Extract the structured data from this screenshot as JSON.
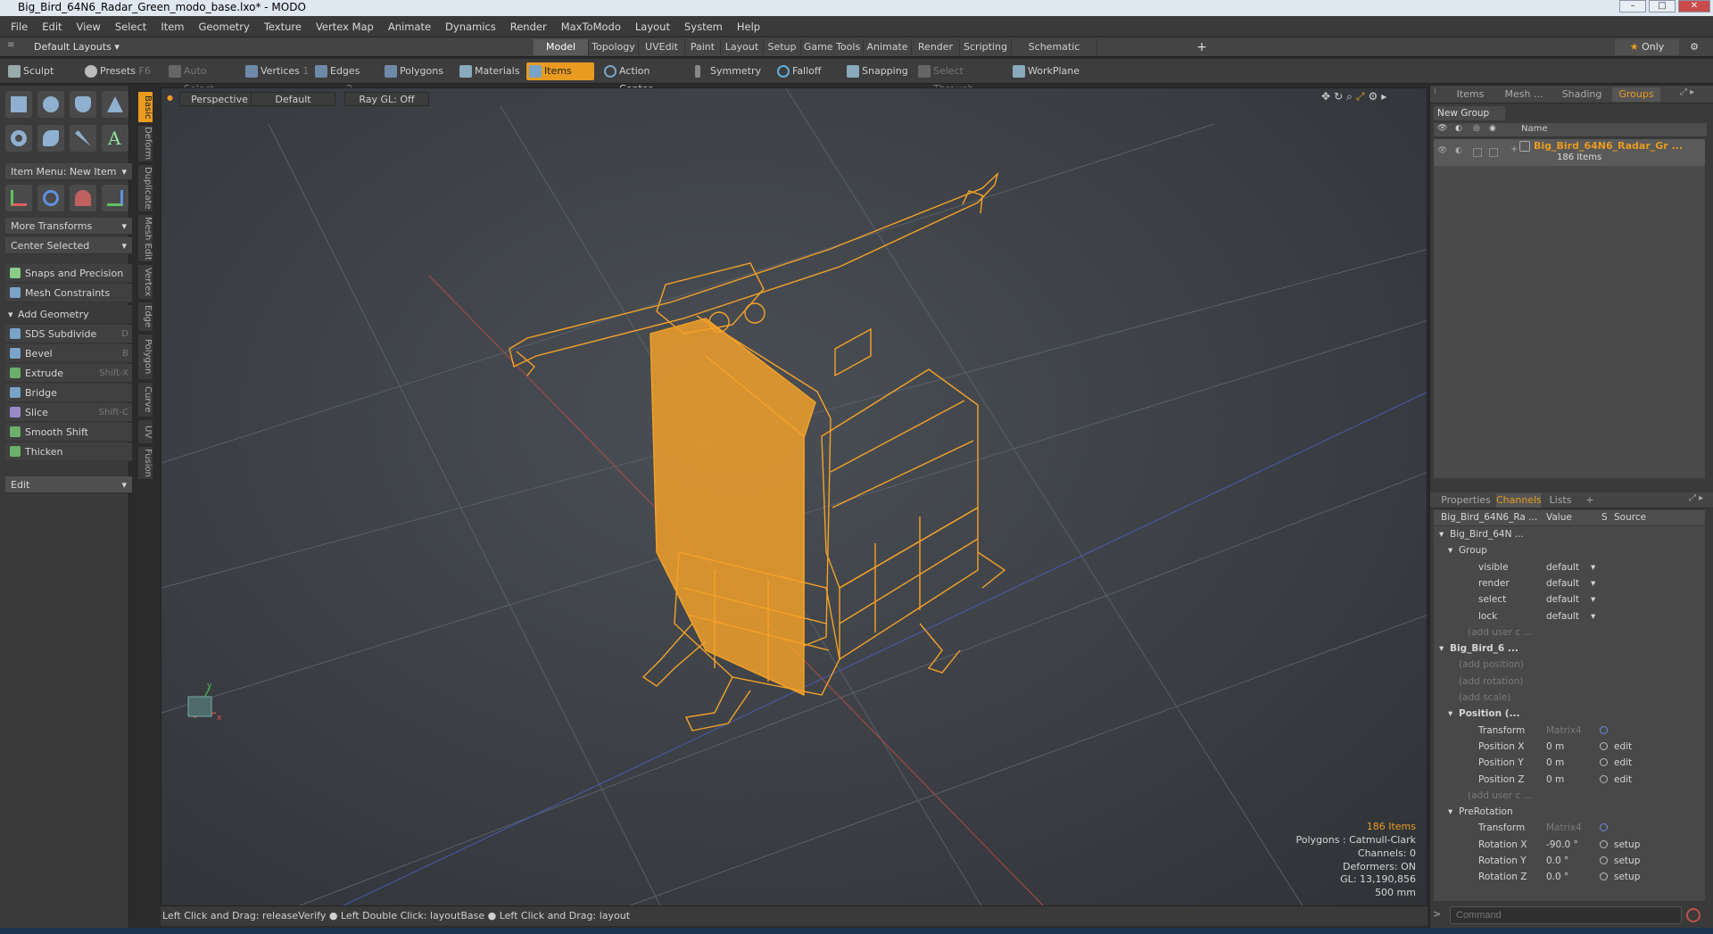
{
  "window": {
    "title": "Big_Bird_64N6_Radar_Green_modo_base.lxo* - MODO"
  },
  "menu": [
    "File",
    "Edit",
    "View",
    "Select",
    "Item",
    "Geometry",
    "Texture",
    "Vertex Map",
    "Animate",
    "Dynamics",
    "Render",
    "MaxToModo",
    "Layout",
    "System",
    "Help"
  ],
  "layouts": {
    "dropdown": "Default Layouts",
    "tabs": [
      "Model",
      "Topology",
      "UVEdit",
      "Paint",
      "Layout",
      "Setup",
      "Game Tools",
      "Animate",
      "Render",
      "Scripting",
      "Schematic Fusion"
    ],
    "active": "Model",
    "add": "+",
    "only": "Only"
  },
  "toolbar": {
    "sculpt": "Sculpt",
    "presets": "Presets",
    "presets_key": "F6",
    "auto_select": "Auto Select",
    "vertices": "Vertices",
    "vertices_key": "1",
    "edges": "Edges",
    "edges_key": "2",
    "polygons": "Polygons",
    "materials": "Materials",
    "items": "Items",
    "action_center": "Action Center",
    "symmetry": "Symmetry",
    "falloff": "Falloff",
    "snapping": "Snapping",
    "select_through": "Select Through",
    "workplane": "WorkPlane"
  },
  "left": {
    "item_menu": "Item Menu: New Item",
    "more_transforms": "More Transforms",
    "center_selected": "Center Selected",
    "snaps": "Snaps and Precision",
    "mesh_constraints": "Mesh Constraints",
    "add_geometry": "Add Geometry",
    "tools": [
      {
        "label": "SDS Subdivide",
        "key": "D"
      },
      {
        "label": "Bevel",
        "key": "B"
      },
      {
        "label": "Extrude",
        "key": "Shift-X"
      },
      {
        "label": "Bridge",
        "key": ""
      },
      {
        "label": "Slice",
        "key": "Shift-C"
      },
      {
        "label": "Smooth Shift",
        "key": ""
      },
      {
        "label": "Thicken",
        "key": ""
      }
    ],
    "edit": "Edit",
    "vtabs": [
      "Basic",
      "Deform",
      "Duplicate",
      "Mesh Edit",
      "Vertex",
      "Edge",
      "Polygon",
      "Curve",
      "UV",
      "Fusion"
    ]
  },
  "viewport": {
    "view": "Perspective",
    "shading": "Default",
    "raygl": "Ray GL: Off",
    "info": {
      "items": "186 Items",
      "polygons": "Polygons : Catmull-Clark",
      "channels": "Channels: 0",
      "deformers": "Deformers: ON",
      "gl": "GL: 13,190,856",
      "scale": "500 mm"
    },
    "wire_color": "#f5a228"
  },
  "groups_panel": {
    "tabs": [
      "Items",
      "Mesh ...",
      "Shading",
      "Groups"
    ],
    "active": "Groups",
    "new_group": "New Group",
    "col_name": "Name",
    "group_name": "Big_Bird_64N6_Radar_Gr ...",
    "group_count": "186 Items"
  },
  "channels_panel": {
    "tabs": [
      "Properties",
      "Channels",
      "Lists"
    ],
    "active": "Channels",
    "add": "+",
    "headers": [
      "Big_Bird_64N6_Ra ...",
      "Value",
      "S",
      "Source"
    ],
    "rows": [
      {
        "name": "Big_Bird_64N ...",
        "value": "",
        "src": "",
        "indent": 1,
        "style": "node"
      },
      {
        "name": "Group",
        "value": "",
        "src": "",
        "indent": 2,
        "style": "node"
      },
      {
        "name": "visible",
        "value": "default",
        "src": "",
        "indent": 3,
        "style": "prop"
      },
      {
        "name": "render",
        "value": "default",
        "src": "",
        "indent": 3,
        "style": "prop"
      },
      {
        "name": "select",
        "value": "default",
        "src": "",
        "indent": 3,
        "style": "prop"
      },
      {
        "name": "lock",
        "value": "default",
        "src": "",
        "indent": 3,
        "style": "prop"
      },
      {
        "name": "(add user c ...",
        "value": "",
        "src": "",
        "indent": 3,
        "style": "dim"
      },
      {
        "name": "Big_Bird_6 ...",
        "value": "",
        "src": "",
        "indent": 1,
        "style": "bold"
      },
      {
        "name": "(add position)",
        "value": "",
        "src": "",
        "indent": 2,
        "style": "dim"
      },
      {
        "name": "(add rotation)",
        "value": "",
        "src": "",
        "indent": 2,
        "style": "dim"
      },
      {
        "name": "(add scale)",
        "value": "",
        "src": "",
        "indent": 2,
        "style": "dim"
      },
      {
        "name": "Position (...",
        "value": "",
        "src": "",
        "indent": 2,
        "style": "bold"
      },
      {
        "name": "Transform",
        "value": "Matrix4",
        "src": "",
        "indent": 3,
        "style": "prop"
      },
      {
        "name": "Position X",
        "value": "0 m",
        "src": "edit",
        "indent": 3,
        "style": "prop"
      },
      {
        "name": "Position Y",
        "value": "0 m",
        "src": "edit",
        "indent": 3,
        "style": "prop"
      },
      {
        "name": "Position Z",
        "value": "0 m",
        "src": "edit",
        "indent": 3,
        "style": "prop"
      },
      {
        "name": "(add user c ...",
        "value": "",
        "src": "",
        "indent": 3,
        "style": "dim"
      },
      {
        "name": "PreRotation",
        "value": "",
        "src": "",
        "indent": 2,
        "style": "node"
      },
      {
        "name": "Transform",
        "value": "Matrix4",
        "src": "",
        "indent": 3,
        "style": "prop"
      },
      {
        "name": "Rotation X",
        "value": "-90.0 °",
        "src": "setup",
        "indent": 3,
        "style": "prop"
      },
      {
        "name": "Rotation Y",
        "value": "0.0 °",
        "src": "setup",
        "indent": 3,
        "style": "prop"
      },
      {
        "name": "Rotation Z",
        "value": "0.0 °",
        "src": "setup",
        "indent": 3,
        "style": "prop"
      }
    ]
  },
  "status": "Left Click and Drag: releaseVerify ● Left Double Click: layoutBase ● Left Click and Drag: layout",
  "command": {
    "placeholder": "Command"
  }
}
